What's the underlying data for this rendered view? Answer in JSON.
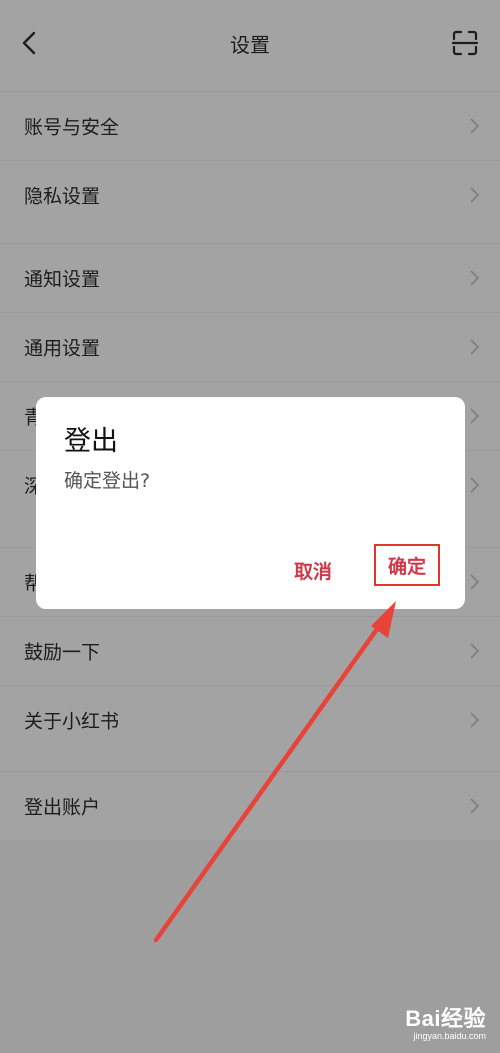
{
  "header": {
    "title": "设置",
    "back_icon": "chevron-left-icon",
    "scan_icon": "scan-icon"
  },
  "settings": {
    "group1": [
      "账号与安全",
      "隐私设置"
    ],
    "group2": [
      "通知设置",
      "通用设置",
      "青",
      "深"
    ],
    "group3": [
      "帮",
      "鼓励一下",
      "关于小红书"
    ],
    "group4": [
      "登出账户"
    ]
  },
  "dialog": {
    "title": "登出",
    "message": "确定登出?",
    "cancel_label": "取消",
    "confirm_label": "确定"
  },
  "watermark": {
    "brand": "Bai经验",
    "url": "jingyan.baidu.com"
  },
  "colors": {
    "accent": "#cf3a4a",
    "highlight_box": "#e1362c",
    "arrow": "#e8433a"
  }
}
